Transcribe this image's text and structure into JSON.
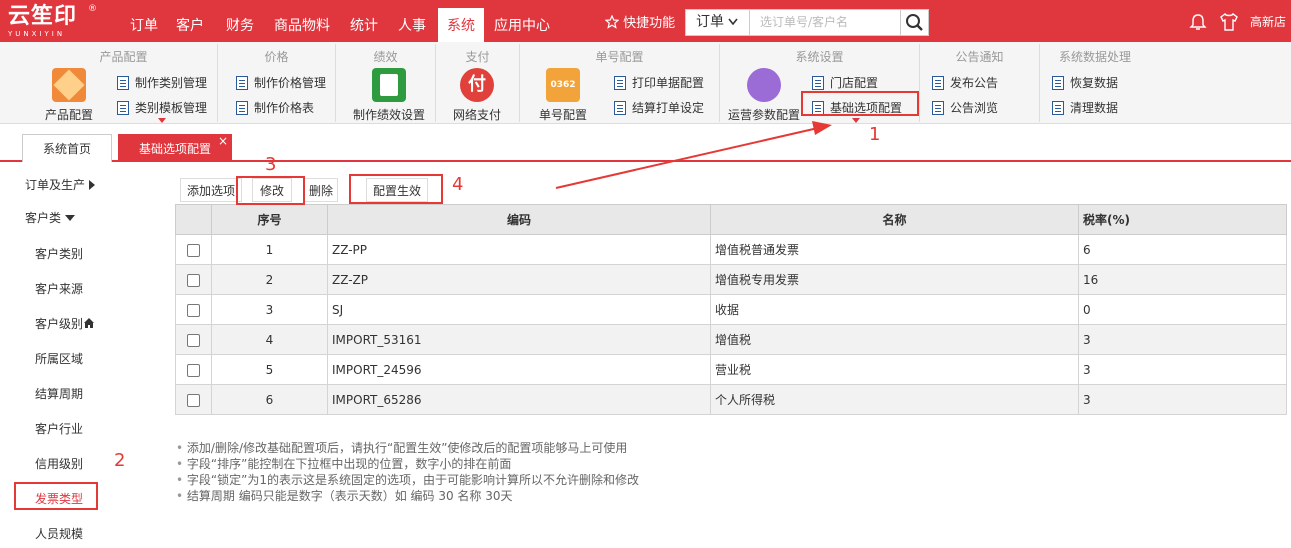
{
  "app": {
    "logo_cn": "云笙印",
    "logo_en": "YUNXIYIN",
    "reg": "®"
  },
  "topnav": {
    "items": [
      "订单",
      "客户",
      "财务",
      "商品物料",
      "统计",
      "人事",
      "系统",
      "应用中心"
    ],
    "active": "系统",
    "quick": "快捷功能",
    "search_type": "订单",
    "search_placeholder": "选订单号/客户名",
    "store": "高新店"
  },
  "ribbon": {
    "groups": [
      {
        "title": "产品配置",
        "big": "产品配置",
        "small": [
          "制作类别管理",
          "类别模板管理"
        ]
      },
      {
        "title": "价格",
        "small": [
          "制作价格管理",
          "制作价格表"
        ]
      },
      {
        "title": "绩效",
        "big": "制作绩效设置"
      },
      {
        "title": "支付",
        "big": "网络支付"
      },
      {
        "title": "单号配置",
        "big": "单号配置",
        "small": [
          "打印单据配置",
          "结算打单设定"
        ]
      },
      {
        "title": "系统设置",
        "big": "运营参数配置",
        "small": [
          "门店配置",
          "基础选项配置"
        ]
      },
      {
        "title": "公告通知",
        "small": [
          "发布公告",
          "公告浏览"
        ]
      },
      {
        "title": "系统数据处理",
        "small": [
          "恢复数据",
          "清理数据"
        ]
      }
    ],
    "stamp_text": "0362",
    "pay_glyph": "付"
  },
  "tabs": {
    "home": "系统首页",
    "current": "基础选项配置",
    "close": "×"
  },
  "sidebar": {
    "orders": "订单及生产",
    "customers": "客户类",
    "items": [
      "客户类别",
      "客户来源",
      "客户级别",
      "所属区域",
      "结算周期",
      "客户行业",
      "信用级别",
      "发票类型",
      "人员规模"
    ]
  },
  "toolbar": {
    "add": "添加选项",
    "edit": "修改",
    "delete": "删除",
    "apply": "配置生效"
  },
  "table": {
    "headers": [
      "序号",
      "编码",
      "名称",
      "税率(%)"
    ],
    "rows": [
      {
        "no": "1",
        "code": "ZZ-PP",
        "name": "增值税普通发票",
        "rate": "6"
      },
      {
        "no": "2",
        "code": "ZZ-ZP",
        "name": "增值税专用发票",
        "rate": "16"
      },
      {
        "no": "3",
        "code": "SJ",
        "name": "收据",
        "rate": "0"
      },
      {
        "no": "4",
        "code": "IMPORT_53161",
        "name": "增值税",
        "rate": "3"
      },
      {
        "no": "5",
        "code": "IMPORT_24596",
        "name": "营业税",
        "rate": "3"
      },
      {
        "no": "6",
        "code": "IMPORT_65286",
        "name": "个人所得税",
        "rate": "3"
      }
    ]
  },
  "notes": [
    "添加/删除/修改基础配置项后，请执行“配置生效”使修改后的配置项能够马上可使用",
    "字段“排序”能控制在下拉框中出现的位置，数字小的排在前面",
    "字段“锁定”为1的表示这是系统固定的选项，由于可能影响计算所以不允许删除和修改",
    "结算周期 编码只能是数字（表示天数）如 编码 30 名称 30天"
  ],
  "annotations": [
    "1",
    "2",
    "3",
    "4"
  ],
  "colors": {
    "brand": "#e0373f",
    "annotation": "#e53935"
  }
}
